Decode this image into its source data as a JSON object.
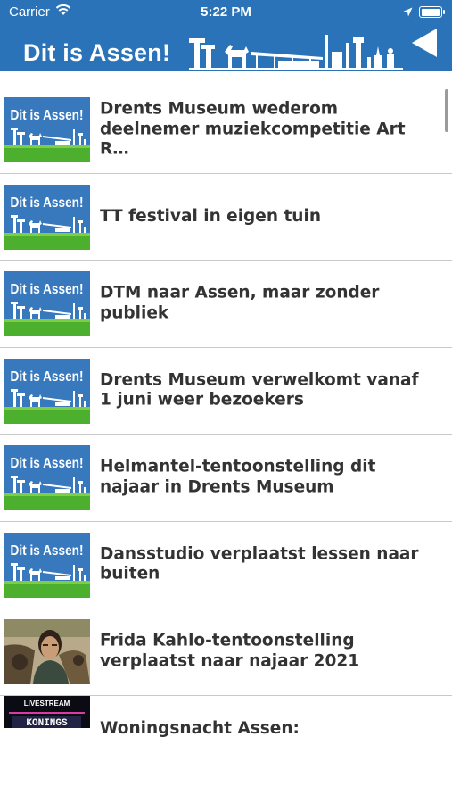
{
  "status": {
    "carrier": "Carrier",
    "time": "5:22 PM"
  },
  "header": {
    "title": "Dit is Assen!",
    "back_icon": "back-triangle-icon"
  },
  "colors": {
    "header_bg": "#2b73b8",
    "thumb_blue": "#3878bd",
    "thumb_grass": "#4caf2e",
    "title_text": "#333333"
  },
  "thumb_logo_text": "Dit is Assen!",
  "items": [
    {
      "title": "Drents Museum wederom deelnemer muziekcompetitie Art R…",
      "thumb": "logo"
    },
    {
      "title": "TT festival in eigen tuin",
      "thumb": "logo"
    },
    {
      "title": "DTM naar Assen, maar zonder publiek",
      "thumb": "logo"
    },
    {
      "title": "Drents Museum verwelkomt vanaf 1 juni weer bezoekers",
      "thumb": "logo"
    },
    {
      "title": "Helmantel-tentoonstelling dit najaar in Drents Museum",
      "thumb": "logo"
    },
    {
      "title": "Dansstudio verplaatst lessen naar buiten",
      "thumb": "logo"
    },
    {
      "title": "Frida Kahlo-tentoonstelling verplaatst naar najaar 2021",
      "thumb": "portrait"
    },
    {
      "title": "Woningsnacht Assen:",
      "thumb": "livestream",
      "thumb_text_top": "LIVESTREAM",
      "thumb_text_main": "KONINGS"
    }
  ]
}
